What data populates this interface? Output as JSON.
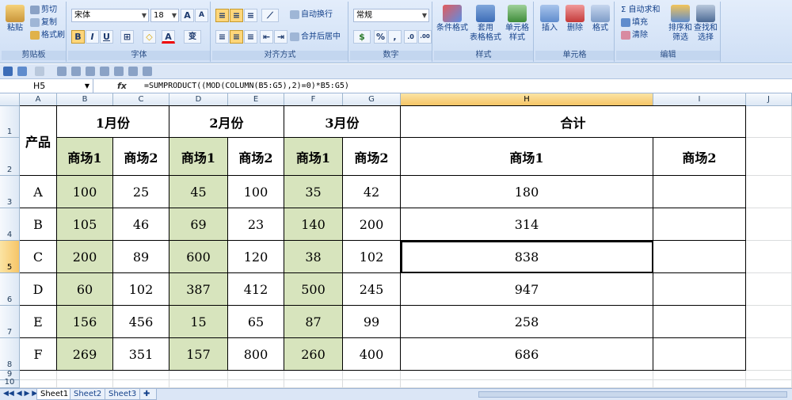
{
  "ribbon": {
    "clipboard": {
      "label": "剪贴板",
      "paste": "粘贴",
      "cut": "剪切",
      "copy": "复制",
      "format_painter": "格式刷"
    },
    "font": {
      "label": "字体",
      "font_name": "宋体",
      "font_size": "18",
      "grow": "A",
      "shrink": "A",
      "bold": "B",
      "italic": "I",
      "underline": "U",
      "border": "⊞",
      "fill": "◇",
      "color": "A",
      "phonetic": "变"
    },
    "alignment": {
      "label": "对齐方式",
      "wrap": "自动换行",
      "merge": "合并后居中"
    },
    "number": {
      "label": "数字",
      "format": "常规",
      "percent": "%",
      "comma": ",",
      "inc_dec": ".0",
      "dec_dec": ".00"
    },
    "styles": {
      "label": "样式",
      "conditional": "条件格式",
      "table": "套用\n表格格式",
      "cell_styles": "单元格\n样式"
    },
    "cells": {
      "label": "单元格",
      "insert": "插入",
      "delete": "删除",
      "format": "格式"
    },
    "editing": {
      "label": "编辑",
      "autosum": "Σ 自动求和",
      "fill": "填充",
      "clear": "清除",
      "sort": "排序和\n筛选",
      "find": "查找和\n选择"
    }
  },
  "formula_bar": {
    "name_box": "H5",
    "fx": "fx",
    "formula": "=SUMPRODUCT((MOD(COLUMN(B5:G5),2)=0)*B5:G5)"
  },
  "columns": [
    "A",
    "B",
    "C",
    "D",
    "E",
    "F",
    "G",
    "H",
    "I",
    "J"
  ],
  "rows": [
    "1",
    "2",
    "3",
    "4",
    "5",
    "6",
    "7",
    "8",
    "9",
    "10"
  ],
  "table": {
    "product_header": "产品",
    "months": [
      "1月份",
      "2月份",
      "3月份"
    ],
    "total": "合计",
    "mall1": "商场1",
    "mall2": "商场2",
    "data": [
      {
        "p": "A",
        "v": [
          "100",
          "25",
          "45",
          "100",
          "35",
          "42"
        ],
        "s": "180"
      },
      {
        "p": "B",
        "v": [
          "105",
          "46",
          "69",
          "23",
          "140",
          "200"
        ],
        "s": "314"
      },
      {
        "p": "C",
        "v": [
          "200",
          "89",
          "600",
          "120",
          "38",
          "102"
        ],
        "s": "838"
      },
      {
        "p": "D",
        "v": [
          "60",
          "102",
          "387",
          "412",
          "500",
          "245"
        ],
        "s": "947"
      },
      {
        "p": "E",
        "v": [
          "156",
          "456",
          "15",
          "65",
          "87",
          "99"
        ],
        "s": "258"
      },
      {
        "p": "F",
        "v": [
          "269",
          "351",
          "157",
          "800",
          "260",
          "400"
        ],
        "s": "686"
      }
    ]
  },
  "sheets": [
    "Sheet1",
    "Sheet2",
    "Sheet3"
  ],
  "colors": {
    "highlight": "#d7e4bd",
    "accent": "#f6c567"
  }
}
